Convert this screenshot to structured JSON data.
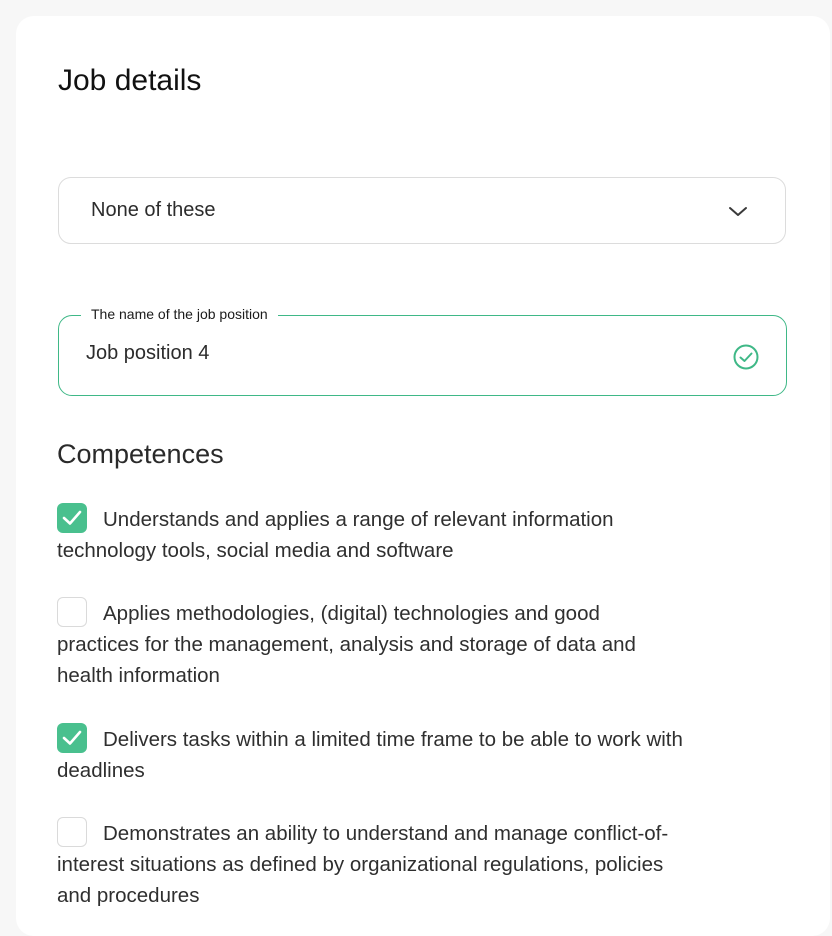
{
  "card": {
    "title": "Job details"
  },
  "position_select": {
    "selected": "None of these",
    "icon": "chevron-down-icon"
  },
  "job_name_field": {
    "label": "The name of the job position",
    "value": "Job position 4",
    "status_icon": "check-circle-icon",
    "accent_color": "#3fb887"
  },
  "competences": {
    "heading": "Competences",
    "checked_color": "#49c08e",
    "items": [
      {
        "checked": true,
        "lines": [
          "Understands and applies a range of relevant information",
          "technology tools, social media and software"
        ]
      },
      {
        "checked": false,
        "lines": [
          "Applies methodologies, (digital) technologies and good",
          "practices for the management, analysis and storage of data and",
          "health information"
        ]
      },
      {
        "checked": true,
        "lines": [
          "Delivers tasks within a limited time frame to be able to work with",
          "deadlines"
        ]
      },
      {
        "checked": false,
        "lines": [
          "Demonstrates an ability to understand and manage conflict-of-",
          "interest situations as defined by organizational regulations, policies",
          "and procedures"
        ]
      }
    ]
  }
}
